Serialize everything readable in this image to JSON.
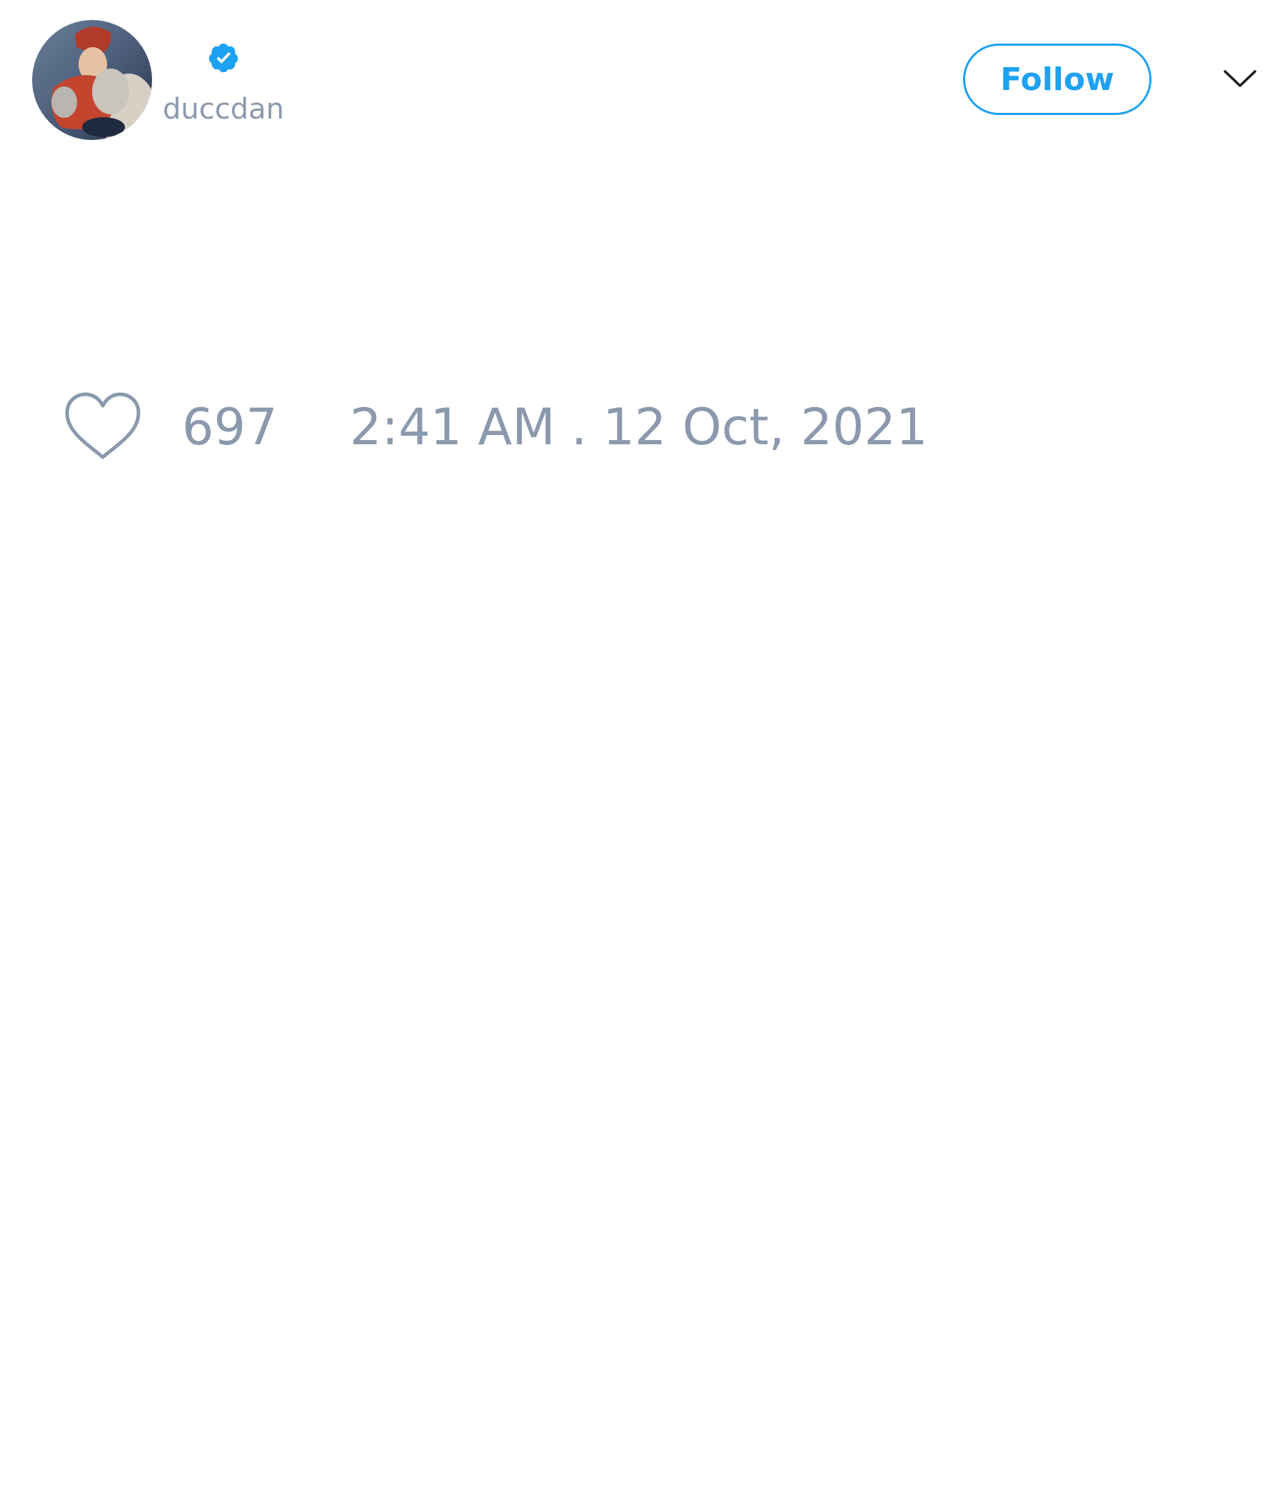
{
  "tweet": {
    "author": {
      "handle": "duccdan",
      "verified": true,
      "avatar": "painting-portrait-avatar"
    },
    "follow_label": "Follow",
    "menu_icon": "chevron-down-icon",
    "like_icon": "heart-outline-icon",
    "like_count": "697",
    "timestamp": "2:41 AM . 12 Oct, 2021"
  },
  "colors": {
    "accent": "#1da1f2",
    "muted_text": "#8b99ad",
    "background": "#ffffff"
  }
}
